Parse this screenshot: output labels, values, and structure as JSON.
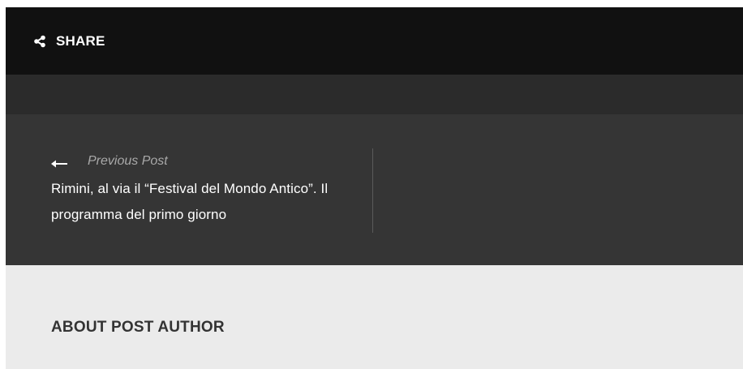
{
  "share": {
    "label": "SHARE",
    "icon": "share-icon"
  },
  "post_nav": {
    "previous": {
      "label": "Previous Post",
      "title": "Rimini, al via il “Festival del Mondo Antico”. Il programma del primo giorno",
      "icon": "arrow-left-icon"
    }
  },
  "about": {
    "heading": "ABOUT POST AUTHOR"
  },
  "colors": {
    "share_bar_bg": "#111111",
    "band_bg": "#2b2b2b",
    "nav_bg": "#353535",
    "about_bg": "#ebebeb",
    "muted_text": "#a9a9a9",
    "heading_text": "#333333"
  }
}
